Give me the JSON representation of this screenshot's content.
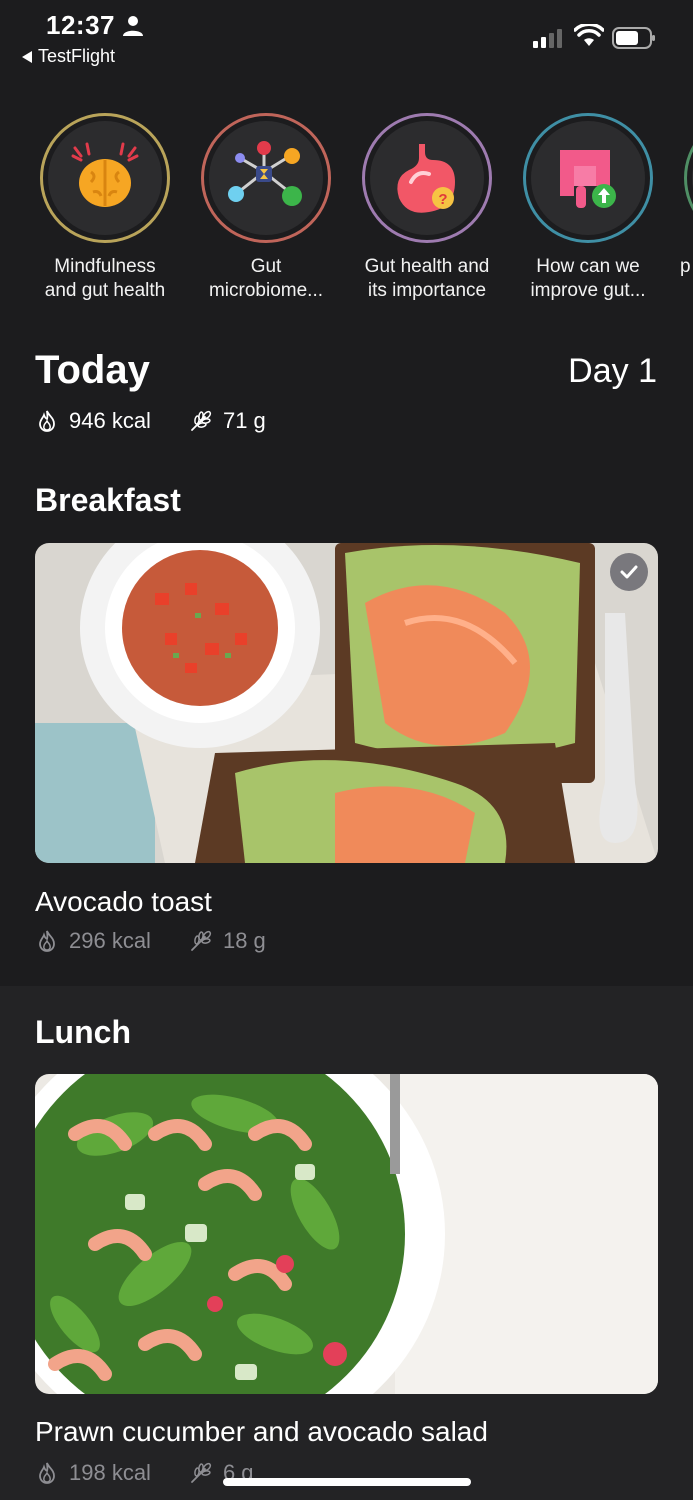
{
  "status_bar": {
    "time": "12:37",
    "back_app": "TestFlight"
  },
  "stories": [
    {
      "label_line1": "Mindfulness",
      "label_line2": "and gut health",
      "icon": "brain-icon",
      "ring_color": "#b9a45a"
    },
    {
      "label_line1": "Gut",
      "label_line2": "microbiome...",
      "icon": "microbiome-network-icon",
      "ring_color": "#c0655a"
    },
    {
      "label_line1": "Gut health and",
      "label_line2": "its importance",
      "icon": "stomach-question-icon",
      "ring_color": "#9e7bb0"
    },
    {
      "label_line1": "How can we",
      "label_line2": "improve gut...",
      "icon": "intestine-up-icon",
      "ring_color": "#3f8fa5"
    },
    {
      "label_line1": "",
      "label_line2": "p",
      "icon": "partial-story-icon",
      "ring_color": "#4f8f65"
    }
  ],
  "today": {
    "title": "Today",
    "day": "Day 1",
    "kcal": "946 kcal",
    "grams": "71 g"
  },
  "meals": [
    {
      "section": "Breakfast",
      "name": "Avocado toast",
      "kcal": "296 kcal",
      "grams": "18 g",
      "completed": true
    },
    {
      "section": "Lunch",
      "name": "Prawn cucumber and avocado salad",
      "kcal": "198 kcal",
      "grams": "6 g",
      "completed": false
    }
  ],
  "colors": {
    "background": "#1c1c1e",
    "lunch_background": "#232325",
    "muted_text": "#8e8e93"
  }
}
